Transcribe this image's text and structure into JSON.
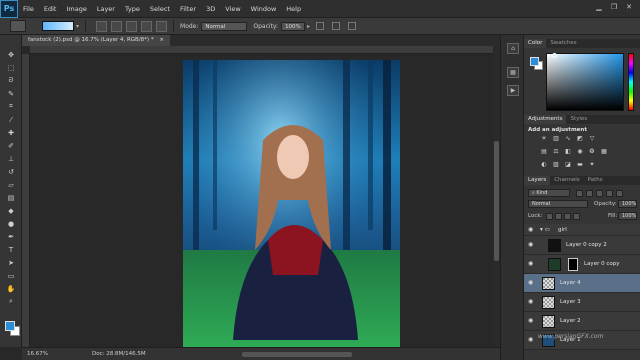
{
  "app": {
    "logo": "Ps"
  },
  "menu": [
    "File",
    "Edit",
    "Image",
    "Layer",
    "Type",
    "Select",
    "Filter",
    "3D",
    "View",
    "Window",
    "Help"
  ],
  "window_controls": {
    "minimize": "▁",
    "restore": "❐",
    "close": "✕"
  },
  "options": {
    "mode_label": "Mode:",
    "mode_value": "Normal",
    "opacity_label": "Opacity:",
    "opacity_value": "100%"
  },
  "document": {
    "tab_title": "fanstock (2).psd @ 16.7% (Layer 4, RGB/8*) *",
    "tab_close": "×"
  },
  "status": {
    "zoom": "16.67%",
    "doc_size": "Doc: 28.8M/146.5M"
  },
  "panels": {
    "color_tabs": [
      "Color",
      "Swatches"
    ],
    "adjustment_tabs": [
      "Adjustments",
      "Styles"
    ],
    "add_adjustment": "Add an adjustment",
    "layers_tabs": [
      "Layers",
      "Channels",
      "Paths"
    ],
    "kind_label": "Kind",
    "blend_mode": "Normal",
    "opacity_label": "Opacity:",
    "opacity_value": "100%",
    "lock_label": "Lock:",
    "fill_label": "Fill:",
    "fill_value": "100%",
    "layers": [
      {
        "name": "girl",
        "kind": "group"
      },
      {
        "name": "Layer 0 copy 2"
      },
      {
        "name": "Layer 0 copy"
      },
      {
        "name": "Layer 4",
        "selected": true
      },
      {
        "name": "Layer 3"
      },
      {
        "name": "Layer 2"
      },
      {
        "name": "Layer 1"
      }
    ]
  },
  "watermark": "www.persianGFX.com",
  "colors": {
    "foreground": "#2a8fd6",
    "background": "#ffffff",
    "selection": "#5a6f88"
  }
}
